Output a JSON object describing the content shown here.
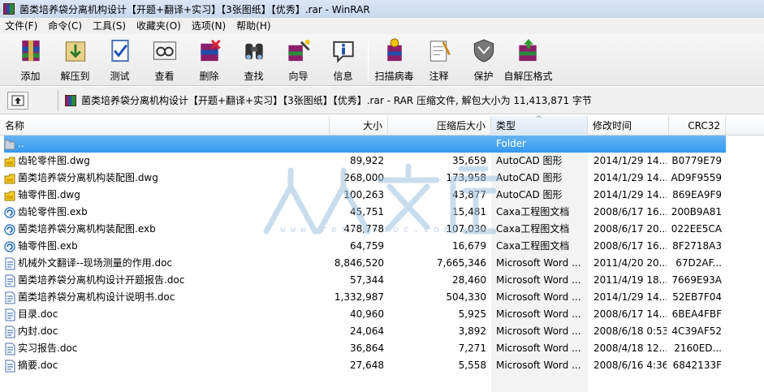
{
  "window": {
    "title": "菌类培养袋分离机构设计【开题+翻译+实习】【3张图纸】【优秀】.rar - WinRAR"
  },
  "menu": [
    "文件(F)",
    "命令(C)",
    "工具(S)",
    "收藏夹(O)",
    "选项(N)",
    "帮助(H)"
  ],
  "toolbar": {
    "group1": [
      {
        "label": "添加",
        "icon": "add-icon"
      },
      {
        "label": "解压到",
        "icon": "extract-icon"
      },
      {
        "label": "测试",
        "icon": "test-icon"
      },
      {
        "label": "查看",
        "icon": "view-icon"
      },
      {
        "label": "删除",
        "icon": "delete-icon"
      },
      {
        "label": "查找",
        "icon": "find-icon"
      },
      {
        "label": "向导",
        "icon": "wizard-icon"
      },
      {
        "label": "信息",
        "icon": "info-icon"
      }
    ],
    "group2": [
      {
        "label": "扫描病毒",
        "icon": "virus-scan-icon"
      },
      {
        "label": "注释",
        "icon": "comment-icon"
      },
      {
        "label": "保护",
        "icon": "protect-icon"
      },
      {
        "label": "自解压格式",
        "icon": "sfx-icon"
      }
    ]
  },
  "pathbar": {
    "text": "菌类培养袋分离机构设计【开题+翻译+实习】【3张图纸】【优秀】.rar - RAR 压缩文件, 解包大小为 11,413,871 字节"
  },
  "columns": {
    "name": "名称",
    "size": "大小",
    "packed": "压缩后大小",
    "type": "类型",
    "modified": "修改时间",
    "crc": "CRC32"
  },
  "files": [
    {
      "name": "..",
      "size": "",
      "packed": "",
      "type": "Folder",
      "modified": "",
      "crc": "",
      "kind": "folder",
      "selected": true
    },
    {
      "name": "齿轮零件图.dwg",
      "size": "89,922",
      "packed": "35,659",
      "type": "AutoCAD 图形",
      "modified": "2014/1/29 14...",
      "crc": "B0779E79",
      "kind": "dwg"
    },
    {
      "name": "菌类培养袋分离机构装配图.dwg",
      "size": "268,000",
      "packed": "173,958",
      "type": "AutoCAD 图形",
      "modified": "2014/1/29 14...",
      "crc": "AD9F9559",
      "kind": "dwg"
    },
    {
      "name": "轴零件图.dwg",
      "size": "100,263",
      "packed": "43,877",
      "type": "AutoCAD 图形",
      "modified": "2014/1/29 14...",
      "crc": "869EA9F9",
      "kind": "dwg"
    },
    {
      "name": "齿轮零件图.exb",
      "size": "45,751",
      "packed": "15,481",
      "type": "Caxa工程图文档",
      "modified": "2008/6/17 16...",
      "crc": "200B9A81",
      "kind": "exb"
    },
    {
      "name": "菌类培养袋分离机构装配图.exb",
      "size": "478,778",
      "packed": "107,030",
      "type": "Caxa工程图文档",
      "modified": "2008/6/17 20...",
      "crc": "022EE5CA",
      "kind": "exb"
    },
    {
      "name": "轴零件图.exb",
      "size": "64,759",
      "packed": "16,679",
      "type": "Caxa工程图文档",
      "modified": "2008/6/17 16...",
      "crc": "8F2718A3",
      "kind": "exb"
    },
    {
      "name": "机械外文翻译--现场测量的作用.doc",
      "size": "8,846,520",
      "packed": "7,665,346",
      "type": "Microsoft Word ...",
      "modified": "2011/4/20 20...",
      "crc": "67D2AF...",
      "kind": "doc"
    },
    {
      "name": "菌类培养袋分离机构设计开题报告.doc",
      "size": "57,344",
      "packed": "28,460",
      "type": "Microsoft Word ...",
      "modified": "2011/4/19 18...",
      "crc": "7669E93A",
      "kind": "doc"
    },
    {
      "name": "菌类培养袋分离机构设计说明书.doc",
      "size": "1,332,987",
      "packed": "504,330",
      "type": "Microsoft Word ...",
      "modified": "2014/1/29 14...",
      "crc": "52EB7F04",
      "kind": "doc"
    },
    {
      "name": "目录.doc",
      "size": "40,960",
      "packed": "5,925",
      "type": "Microsoft Word ...",
      "modified": "2008/6/17 14...",
      "crc": "6BEA4FBF",
      "kind": "doc"
    },
    {
      "name": "内封.doc",
      "size": "24,064",
      "packed": "3,892",
      "type": "Microsoft Word ...",
      "modified": "2008/6/18 0:53",
      "crc": "4C39AF52",
      "kind": "doc"
    },
    {
      "name": "实习报告.doc",
      "size": "36,864",
      "packed": "7,271",
      "type": "Microsoft Word ...",
      "modified": "2008/4/18 12...",
      "crc": "2160ED...",
      "kind": "doc"
    },
    {
      "name": "摘要.doc",
      "size": "27,648",
      "packed": "5,558",
      "type": "Microsoft Word ...",
      "modified": "2008/6/16 4:36",
      "crc": "6842133F",
      "kind": "doc"
    }
  ],
  "watermark": {
    "text": "人人文库",
    "url": "www.renrendoc.com"
  },
  "colors": {
    "selection": "#3399ee",
    "titlebar": "#dbe6f4",
    "watermark": "#9ec3e0"
  }
}
